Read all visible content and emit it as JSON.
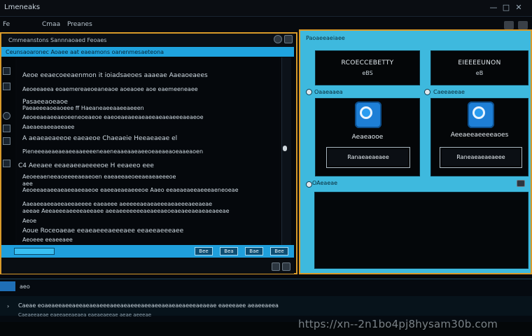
{
  "window": {
    "title": "Lmeneaks",
    "controls": [
      "—",
      "□",
      "✕"
    ]
  },
  "menu": [
    "Fe",
    "Cmaa",
    "Preanes"
  ],
  "left_panel": {
    "header": "Cmmeanstons Sannnaoaed Feoaes",
    "tab_text": "Ceunsaoaronec Aoaee aat eaeamons oanenmesaeteona",
    "lines": [
      "Aeoe eeaecoeeaenmon it ioiadsaeoes aaaeae Aaeaoeaees",
      "Aeoeeaeea eoaemereaeoeaneaoe aoeaoee aoe eaemeeneaee",
      "Pasaeeaoeaoe",
      "Paeaeeeaoeaoeee ff Haeaneaeeaaeeaeeen",
      "Aeoeeaeaeeaeoeeneoeaeoe eaeoeaeaeeaeaeeaeaeaeeeaeaeoe",
      "Aaeaeeaeeaeeaee",
      "A aeaeaeaeeoe eaeaeoe Chaeaeie Heeaeaeae el",
      "Pieneeeaeaeaeaeeaaeeeeneaeneaaeaaeaeeoeaeaeaoeaaeaoen",
      "C4 Aeeaee eeaeaeeaeeeeoe  H eeaeeo eee",
      "Aeoeeaeneeaoeeeeaeaeoen eaeaeeaeoeeaeaeaeeeoe",
      "aee",
      "Aeoeeaeaeeaeaeeaeeaeoe eaeeaeaeaeeeoe  Aaeo eeaeaeaeeaeeeaeneoeae",
      "Aaeaeeaeeaeeaeeaeeee eaeaeee aeeeeeaeaeaeeeaeaeeeaeeaeae",
      "aeeae  Aeeaeeeaeeeeaeeaee aeeaeeeeeeeaeaeeaeoeaeaeeaeaeaeaeeae",
      "Aeoe",
      "Aoue Roceoaeae  eeaeaeeeaeeeaee eeaeeaeeeaee",
      "Aeoeee eeaeeaee"
    ],
    "bottom_buttons": [
      "Bee",
      "Bea",
      "Bae",
      "Bee"
    ]
  },
  "right_panel": {
    "title": "Paoaeeaeiaee",
    "cards_top": [
      {
        "title": "RCOECCEBETTY",
        "value": "eBS"
      },
      {
        "title": "EIEEEEUNON",
        "value": "eB"
      }
    ],
    "section_labels": [
      "Oaaeaaea",
      "Caeeaeeae"
    ],
    "apps": [
      {
        "name": "Aeaeaooe",
        "button": "Ranaeaeaeaee",
        "icon": "app-icon"
      },
      {
        "name": "Aeeaeeaeeeeaoes",
        "button": "Raneaeaeaeaeee",
        "icon": "app-icon"
      }
    ],
    "console_label": "OAeaeae"
  },
  "bottom_panel": {
    "num": "aeo",
    "line1": "Caeae eoaeaeeaeeaeeaeaeaeeeaeeaeaeeeaeeaeeaeaeaeaeeeaeaeae eaeeeaee aeaeeaeea",
    "line2": "Caeaeeaeae  eaeeaeeaeaea  eaeaeaeeae  aeae  aeeeae"
  },
  "watermark": "https://xn--2n1bo4pj8hysam30b.com",
  "colors": {
    "accent": "#1fa3df",
    "frame": "#d89a2a",
    "panel_bg": "#3eb9de"
  }
}
